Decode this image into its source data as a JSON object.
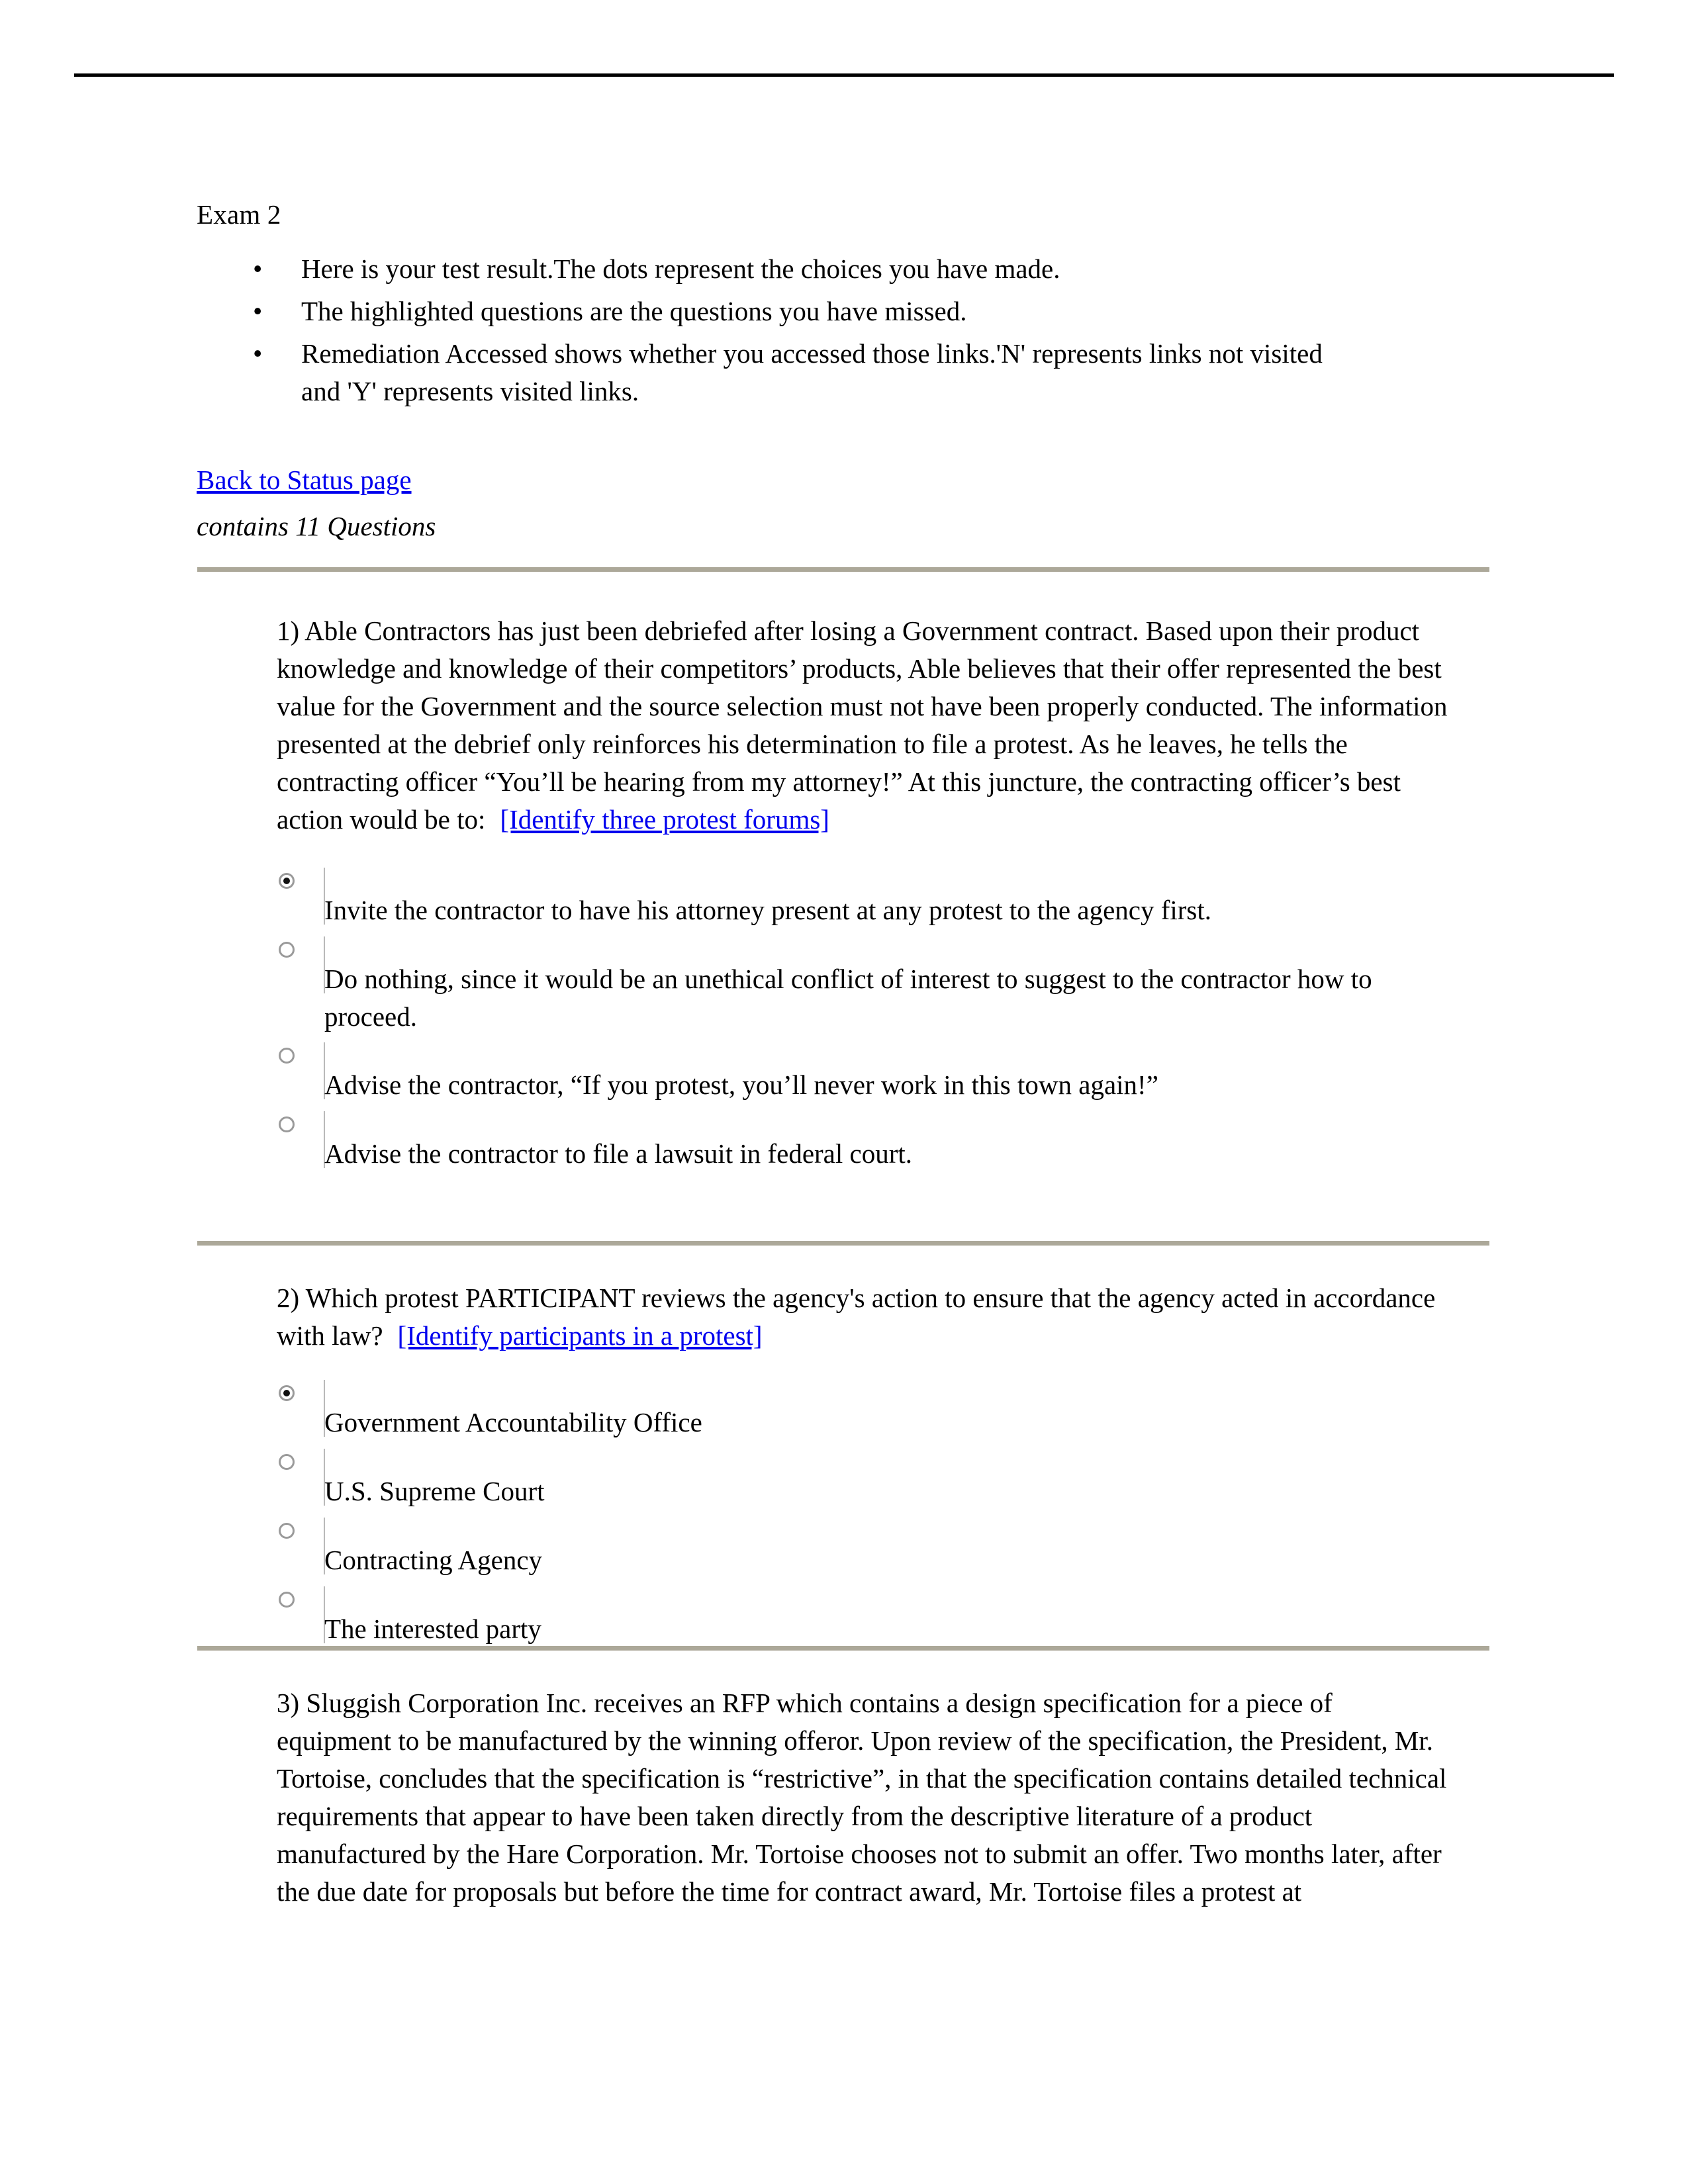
{
  "document": {
    "title": "Exam 2",
    "intro_bullets": [
      "Here is your test result.The dots represent the choices you have made.",
      "The highlighted questions are the questions you have missed.",
      "Remediation Accessed shows whether you accessed those links.'N' represents links not visited and 'Y' represents visited links."
    ],
    "back_link": "Back to Status page",
    "question_count_note": "contains 11 Questions",
    "link_color": "#0000ee",
    "separator_color": "#aca899",
    "header_rule_color": "#000000",
    "bullet_glyph": "•"
  },
  "questions": [
    {
      "number": "1)",
      "text": "Able Contractors has just been debriefed after losing a Government contract. Based upon their product knowledge and knowledge of their competitors’ products, Able believes that their offer represented the best value for the Government and the source selection must not have been properly conducted. The information presented at the debrief only reinforces his determination to file a protest. As he leaves, he tells the contracting officer “You’ll be hearing from my attorney!” At this juncture, the contracting officer’s best action would be to:",
      "remediation_link": "[Identify three protest forums]",
      "options": [
        {
          "label": "Invite the contractor to have his attorney present at any protest to the agency first.",
          "selected": true
        },
        {
          "label": "Do nothing, since it would be an unethical conflict of interest to suggest to the contractor how to proceed.",
          "selected": false
        },
        {
          "label": "Advise the contractor, “If you protest, you’ll never work in this town again!”",
          "selected": false
        },
        {
          "label": "Advise the contractor to file a lawsuit in federal court.",
          "selected": false
        }
      ]
    },
    {
      "number": "2)",
      "text": "Which protest PARTICIPANT reviews the agency's action to ensure that the agency acted in accordance with law?",
      "remediation_link": "[Identify participants in a protest]",
      "options": [
        {
          "label": "Government Accountability Office",
          "selected": true
        },
        {
          "label": "U.S. Supreme Court",
          "selected": false
        },
        {
          "label": "Contracting Agency",
          "selected": false
        },
        {
          "label": "The interested party",
          "selected": false
        }
      ]
    },
    {
      "number": "3)",
      "text": "Sluggish Corporation Inc. receives an RFP which contains a design specification for a piece of equipment to be manufactured by the winning offeror. Upon review of the specification, the President, Mr. Tortoise, concludes that the specification is “restrictive”, in that the specification contains detailed technical requirements that appear to have been taken directly from the descriptive literature of a product manufactured by the Hare Corporation. Mr. Tortoise chooses not to submit an offer. Two months later, after the due date for proposals but before the time for contract award, Mr. Tortoise files a protest at",
      "remediation_link": "",
      "options": []
    }
  ]
}
